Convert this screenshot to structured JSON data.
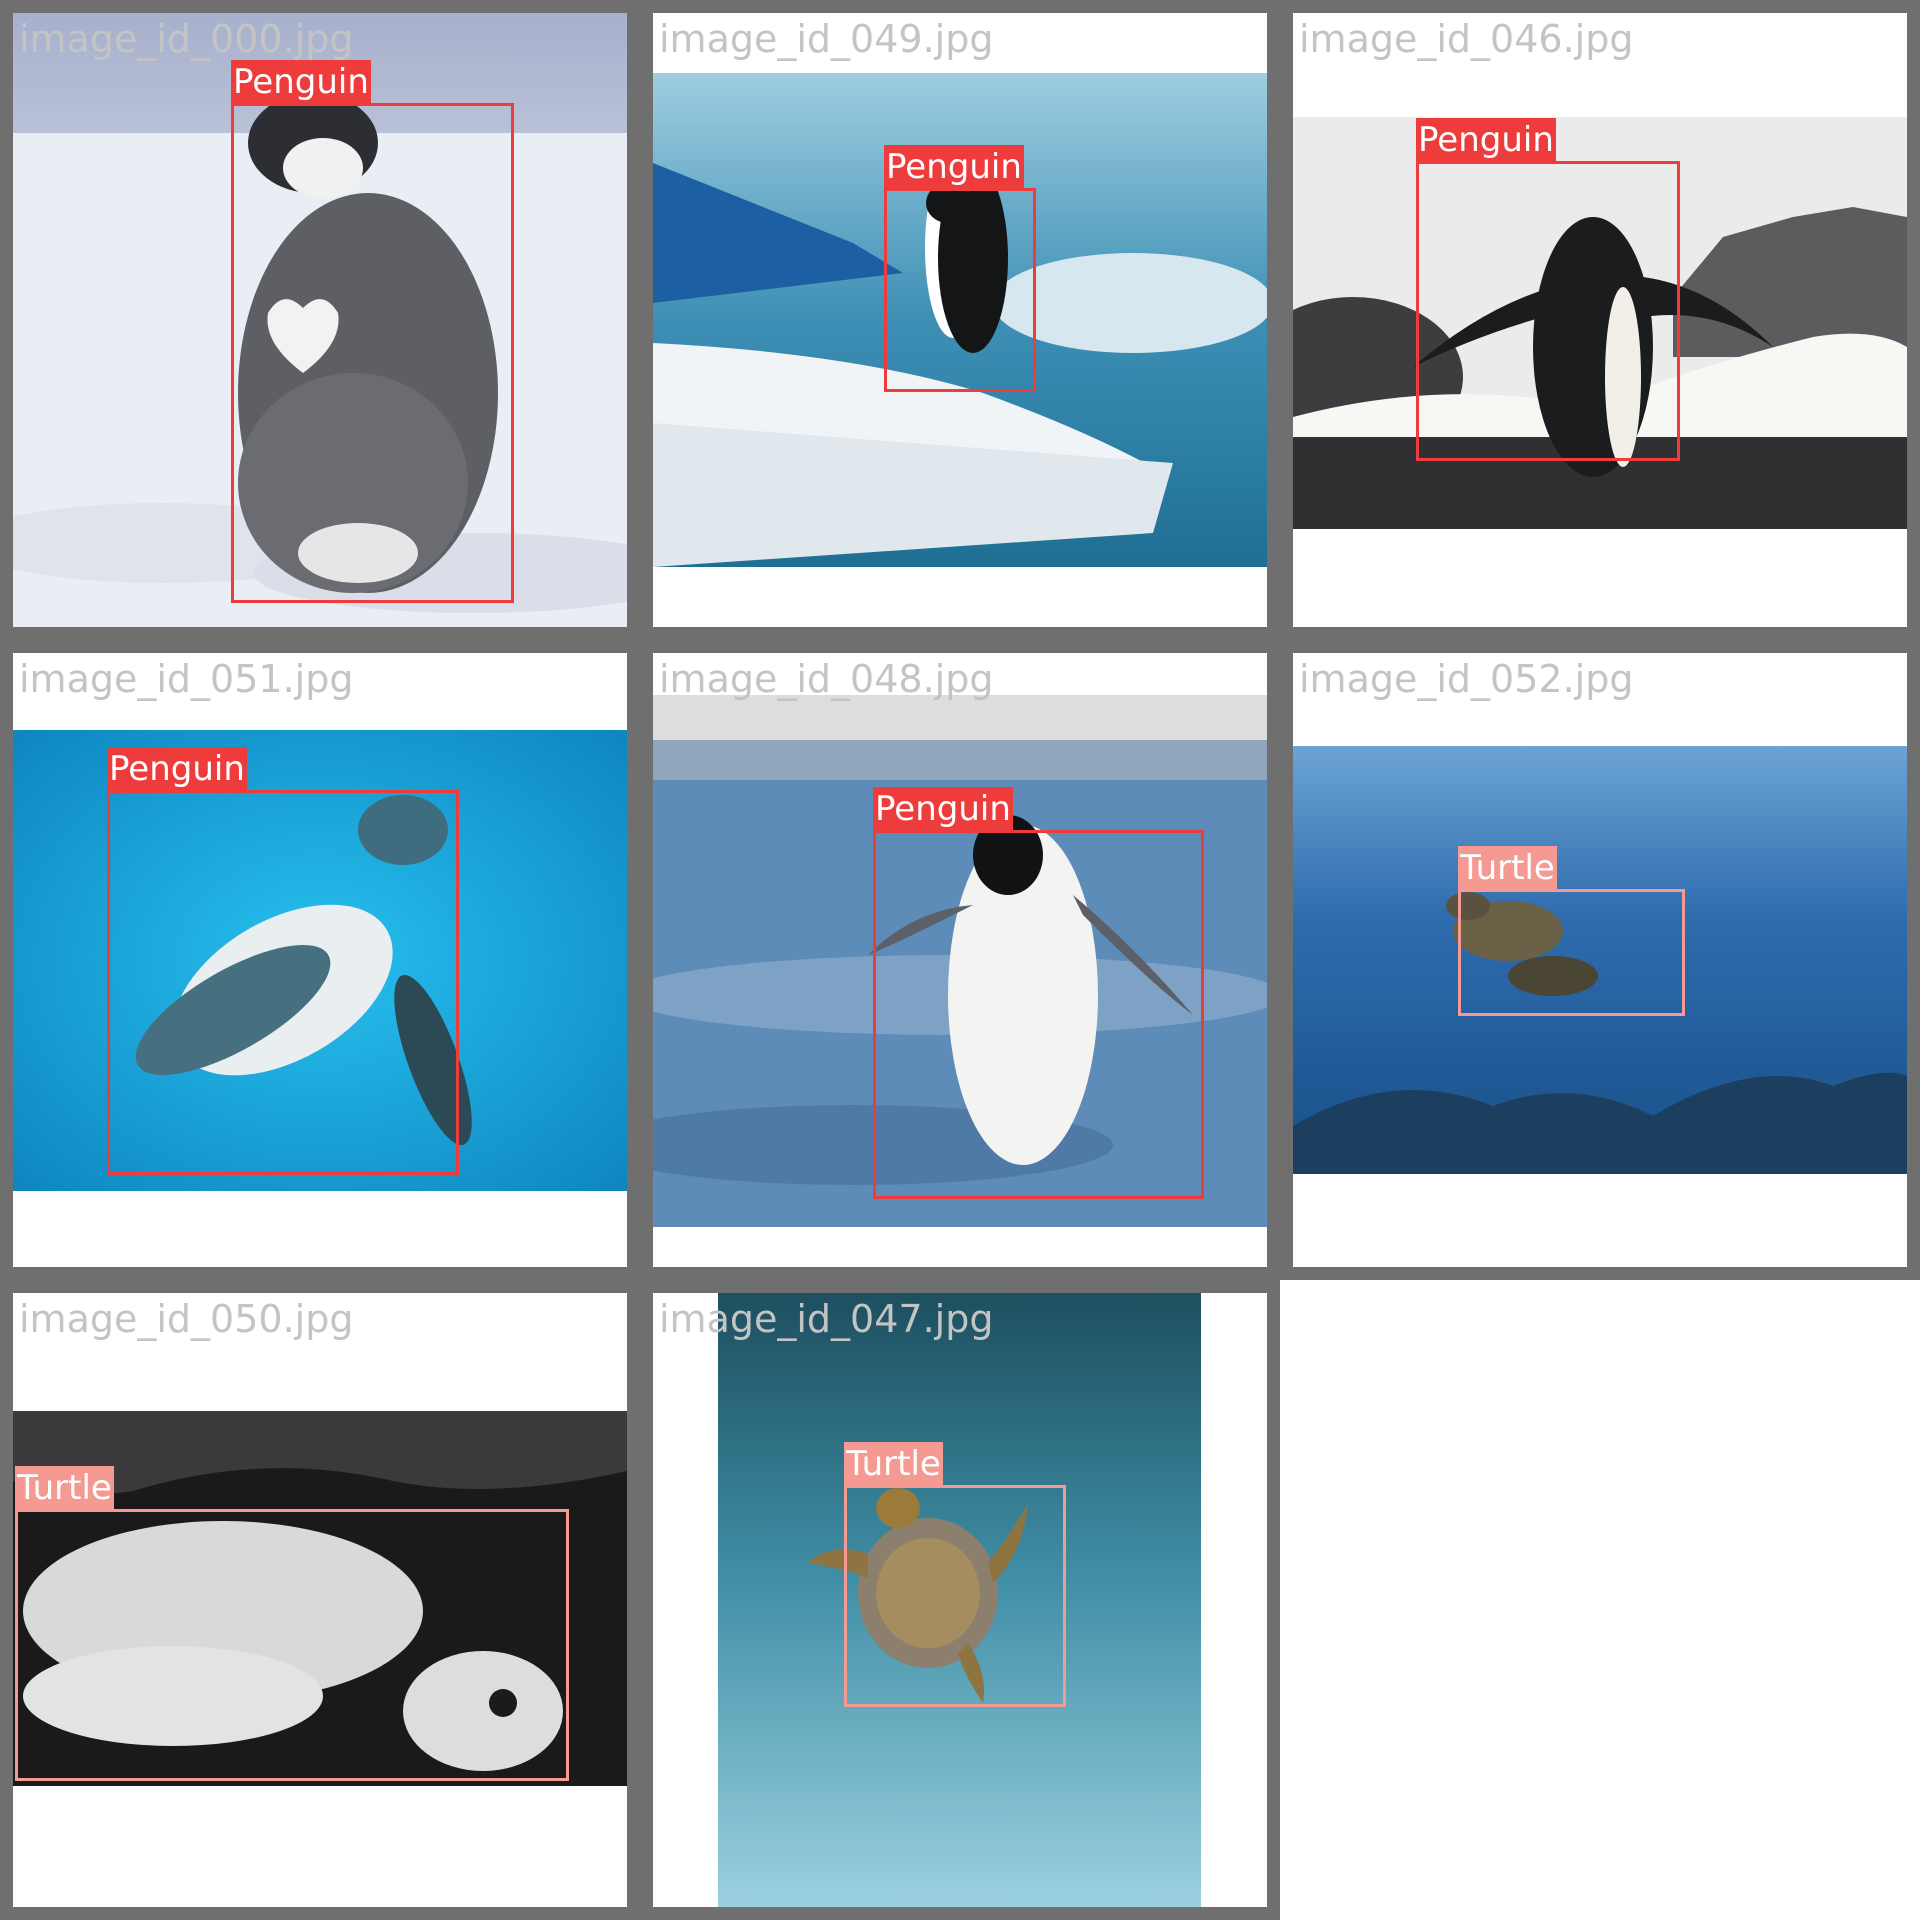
{
  "tiles": [
    {
      "filename": "image_id_000.jpg",
      "labels": [
        "Penguin"
      ]
    },
    {
      "filename": "image_id_049.jpg",
      "labels": [
        "Penguin"
      ]
    },
    {
      "filename": "image_id_046.jpg",
      "labels": [
        "Penguin"
      ]
    },
    {
      "filename": "image_id_051.jpg",
      "labels": [
        "Penguin"
      ]
    },
    {
      "filename": "image_id_048.jpg",
      "labels": [
        "Penguin"
      ]
    },
    {
      "filename": "image_id_052.jpg",
      "labels": [
        "Turtle"
      ]
    },
    {
      "filename": "image_id_050.jpg",
      "labels": [
        "Turtle"
      ]
    },
    {
      "filename": "image_id_047.jpg",
      "labels": [
        "Turtle"
      ]
    }
  ],
  "colors": {
    "penguin": "#ee3b3b",
    "turtle": "#f59a93",
    "border": "#6f6f6f",
    "filename_text": "#c4c4c4"
  }
}
